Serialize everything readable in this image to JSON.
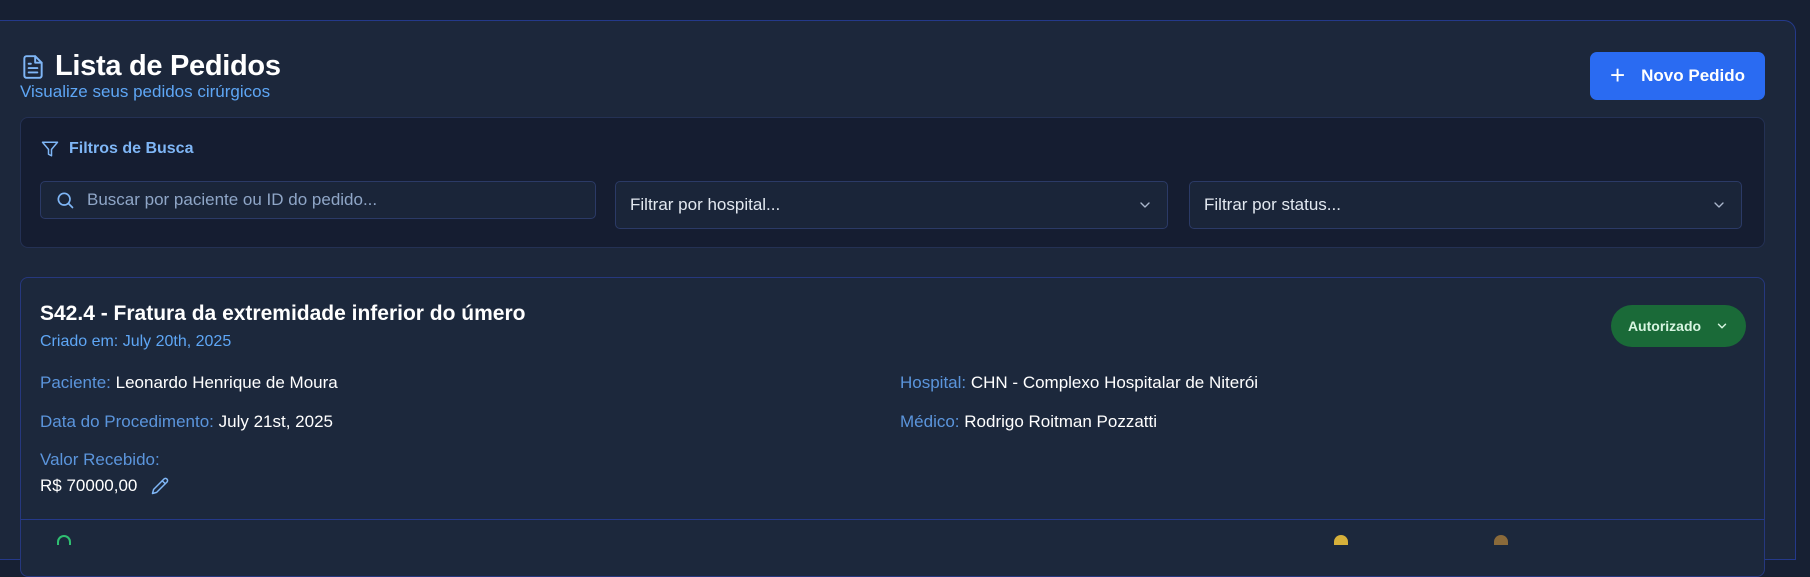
{
  "header": {
    "title": "Lista de Pedidos",
    "subtitle": "Visualize seus pedidos cirúrgicos",
    "title_icon": "document-icon",
    "new_button_label": "Novo Pedido",
    "new_button_icon": "plus-icon"
  },
  "filters": {
    "title": "Filtros de Busca",
    "icon": "filter-icon",
    "search_placeholder": "Buscar por paciente ou ID do pedido...",
    "hospital_placeholder": "Filtrar por hospital...",
    "status_placeholder": "Filtrar por status..."
  },
  "orders": [
    {
      "title": "S42.4 - Fratura da extremidade inferior do úmero",
      "created": "Criado em: July 20th, 2025",
      "status": "Autorizado",
      "patient_label": "Paciente:",
      "patient": "Leonardo Henrique de Moura",
      "date_label": "Data do Procedimento:",
      "date": "July 21st, 2025",
      "hospital_label": "Hospital:",
      "hospital": "CHN - Complexo Hospitalar de Niterói",
      "doctor_label": "Médico:",
      "doctor": "Rodrigo Roitman Pozzatti",
      "value_label": "Valor Recebido:",
      "value": "R$ 70000,00",
      "edit_icon": "pencil-icon"
    }
  ],
  "colors": {
    "accent": "#2a6bf2",
    "status_authorized": "#1a6a38",
    "label_blue": "#5b95dc",
    "background": "#172033"
  }
}
